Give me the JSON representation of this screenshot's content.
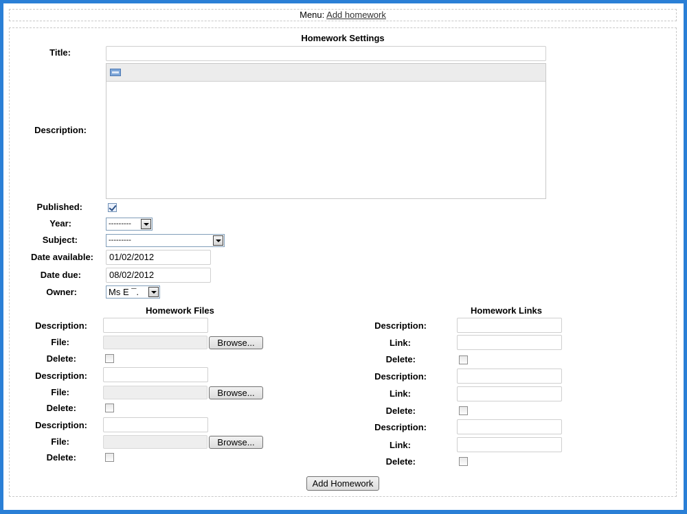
{
  "menu": {
    "label": "Menu:",
    "link": "Add homework"
  },
  "settings": {
    "title": "Homework Settings",
    "title_label": "Title:",
    "title_value": "",
    "description_label": "Description:",
    "published_label": "Published:",
    "published": true,
    "year_label": "Year:",
    "year_value": "---------",
    "subject_label": "Subject:",
    "subject_value": "---------",
    "date_available_label": "Date available:",
    "date_available": "01/02/2012",
    "date_due_label": "Date due:",
    "date_due": "08/02/2012",
    "owner_label": "Owner:",
    "owner_value": "Ms E ¯."
  },
  "files": {
    "title": "Homework Files",
    "description_label": "Description:",
    "file_label": "File:",
    "delete_label": "Delete:",
    "browse_label": "Browse..."
  },
  "links": {
    "title": "Homework Links",
    "description_label": "Description:",
    "link_label": "Link:",
    "delete_label": "Delete:"
  },
  "submit_label": "Add Homework"
}
